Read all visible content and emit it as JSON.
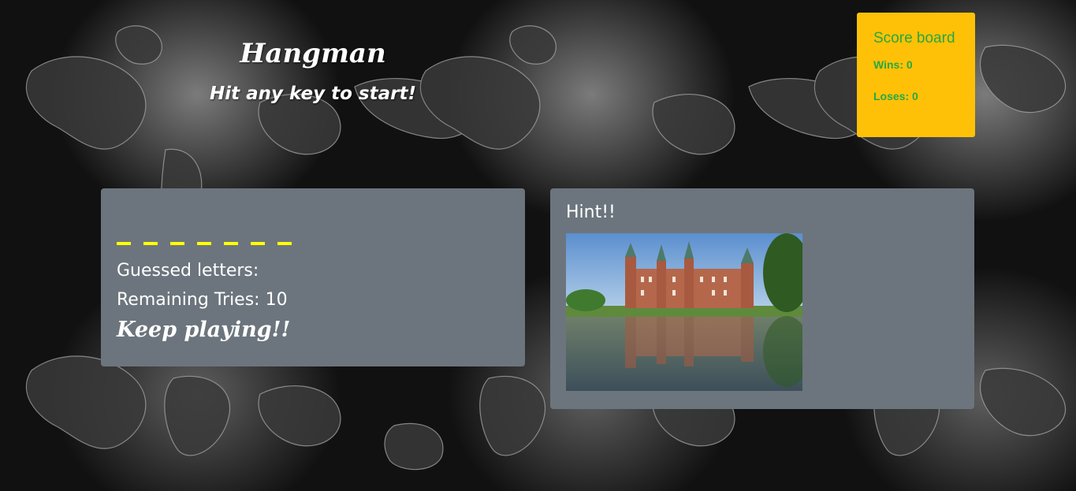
{
  "header": {
    "title": "Hangman",
    "subtitle": "Hit any key to start!"
  },
  "scoreboard": {
    "title": "Score board",
    "wins": "Wins: 0",
    "loses": "Loses: 0"
  },
  "game": {
    "word_blanks": [
      "_",
      "_",
      "_",
      "_",
      "_",
      "_",
      "_"
    ],
    "guessed_letters": "Guessed letters:",
    "remaining_tries": "Remaining Tries: 10",
    "status": "Keep playing!!"
  },
  "hint": {
    "title": "Hint!!",
    "image_subject": "castle-reflected-in-lake"
  },
  "colors": {
    "scoreboard_bg": "#ffc107",
    "scoreboard_text": "#28a745",
    "card_bg": "#6c757d",
    "blank_color": "#ffff00"
  }
}
